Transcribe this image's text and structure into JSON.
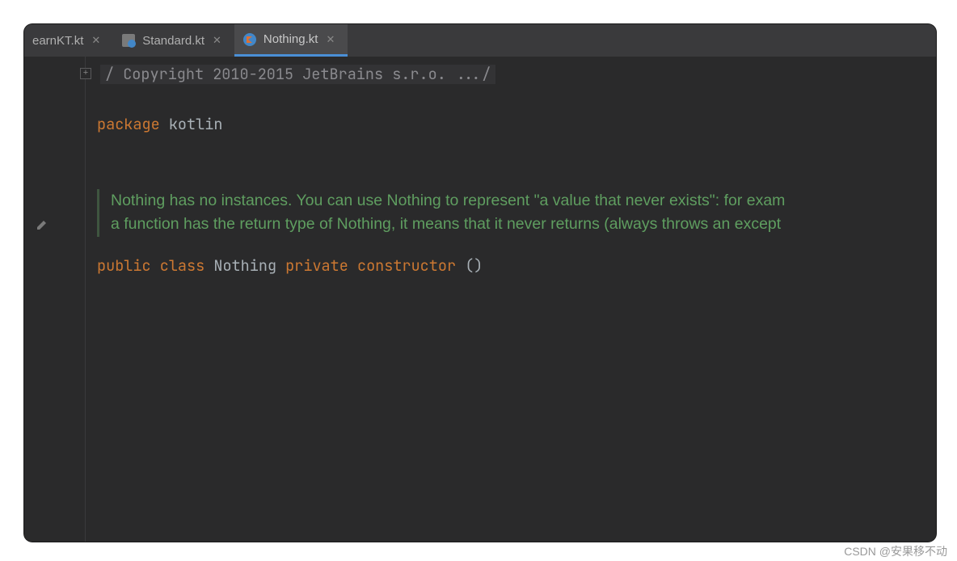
{
  "tabs": [
    {
      "label": "earnKT.kt",
      "active": false
    },
    {
      "label": "Standard.kt",
      "active": false
    },
    {
      "label": "Nothing.kt",
      "active": true
    }
  ],
  "code": {
    "copyright": "/ Copyright 2010-2015 JetBrains s.r.o. .../",
    "package_kw": "package",
    "package_name": "kotlin",
    "doc_line1": "Nothing has no instances. You can use Nothing to represent \"a value that never exists\": for exam",
    "doc_line2": "a function has the return type of Nothing, it means that it never returns (always throws an except",
    "public_kw": "public",
    "class_kw": "class",
    "class_name": "Nothing",
    "private_kw": "private",
    "constructor_kw": "constructor",
    "parens": "()"
  },
  "watermark": "CSDN @安果移不动"
}
